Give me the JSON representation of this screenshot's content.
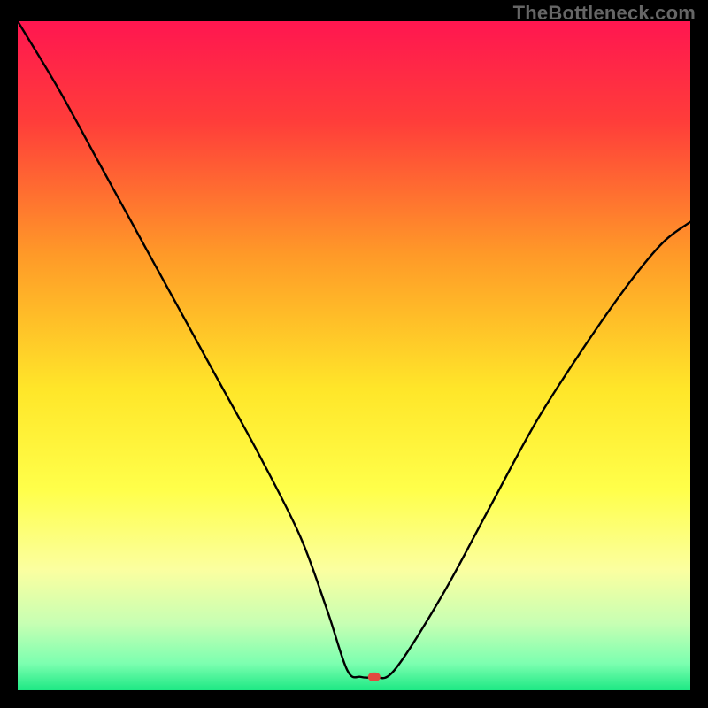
{
  "watermark": "TheBottleneck.com",
  "chart_data": {
    "type": "line",
    "title": "",
    "xlabel": "",
    "ylabel": "",
    "xlim": [
      0,
      100
    ],
    "ylim": [
      0,
      100
    ],
    "grid": false,
    "legend": false,
    "gradient_stops": [
      {
        "offset": 0.0,
        "color": "#ff1650"
      },
      {
        "offset": 0.15,
        "color": "#ff3d3a"
      },
      {
        "offset": 0.35,
        "color": "#ff9a28"
      },
      {
        "offset": 0.55,
        "color": "#ffe629"
      },
      {
        "offset": 0.7,
        "color": "#ffff4a"
      },
      {
        "offset": 0.82,
        "color": "#fbffa0"
      },
      {
        "offset": 0.9,
        "color": "#c7ffb3"
      },
      {
        "offset": 0.96,
        "color": "#7cffb0"
      },
      {
        "offset": 1.0,
        "color": "#1de884"
      }
    ],
    "series": [
      {
        "name": "curve",
        "x": [
          0,
          6,
          12,
          18,
          24,
          30,
          36,
          42,
          46,
          49,
          51,
          53,
          56,
          63,
          70,
          77,
          84,
          91,
          96,
          100
        ],
        "values": [
          100,
          90,
          79,
          68,
          57,
          46,
          35,
          23,
          12,
          3,
          2,
          2,
          3,
          14,
          27,
          40,
          51,
          61,
          67,
          70
        ]
      }
    ],
    "marker": {
      "x": 53,
      "y": 2,
      "color": "#e24a3f"
    }
  }
}
